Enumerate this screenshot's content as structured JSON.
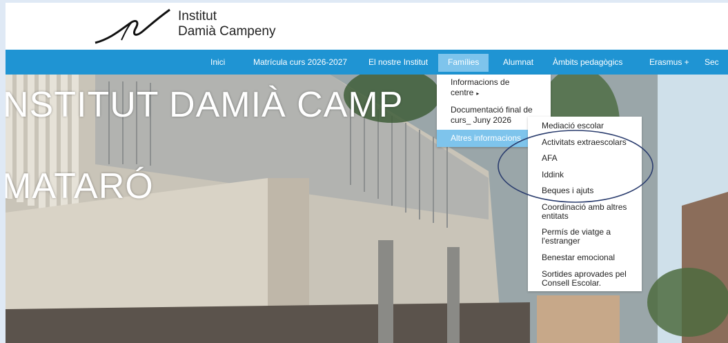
{
  "logo": {
    "line1": "Institut",
    "line2": "Damià Campeny"
  },
  "nav": {
    "items": [
      "Inici",
      "Matrícula curs 2026-2027",
      "El nostre Institut",
      "Famílies",
      "Alumnat",
      "Àmbits pedagògics",
      "Erasmus +",
      "Sec"
    ],
    "active_index": 3
  },
  "hero": {
    "line1": "NSTITUT DAMIÀ CAMP",
    "line2": "MATARÓ"
  },
  "submenu_families": {
    "items": [
      "Informacions de centre",
      "Documentació final de curs_ Juny 2026",
      "Altres informacions"
    ],
    "has_arrow": [
      true,
      false,
      false
    ],
    "selected_index": 2
  },
  "submenu_altres": {
    "items": [
      "Mediació escolar",
      "Activitats extraescolars",
      "AFA",
      "Iddink",
      "Beques i ajuts",
      "Coordinació amb altres entitats",
      "Permís de viatge a l'estranger",
      "Benestar emocional",
      "Sortides aprovades pel Consell Escolar."
    ]
  },
  "colors": {
    "nav": "#1f94d3",
    "active": "#7ec4ec",
    "annotation": "#2b3d6e"
  }
}
